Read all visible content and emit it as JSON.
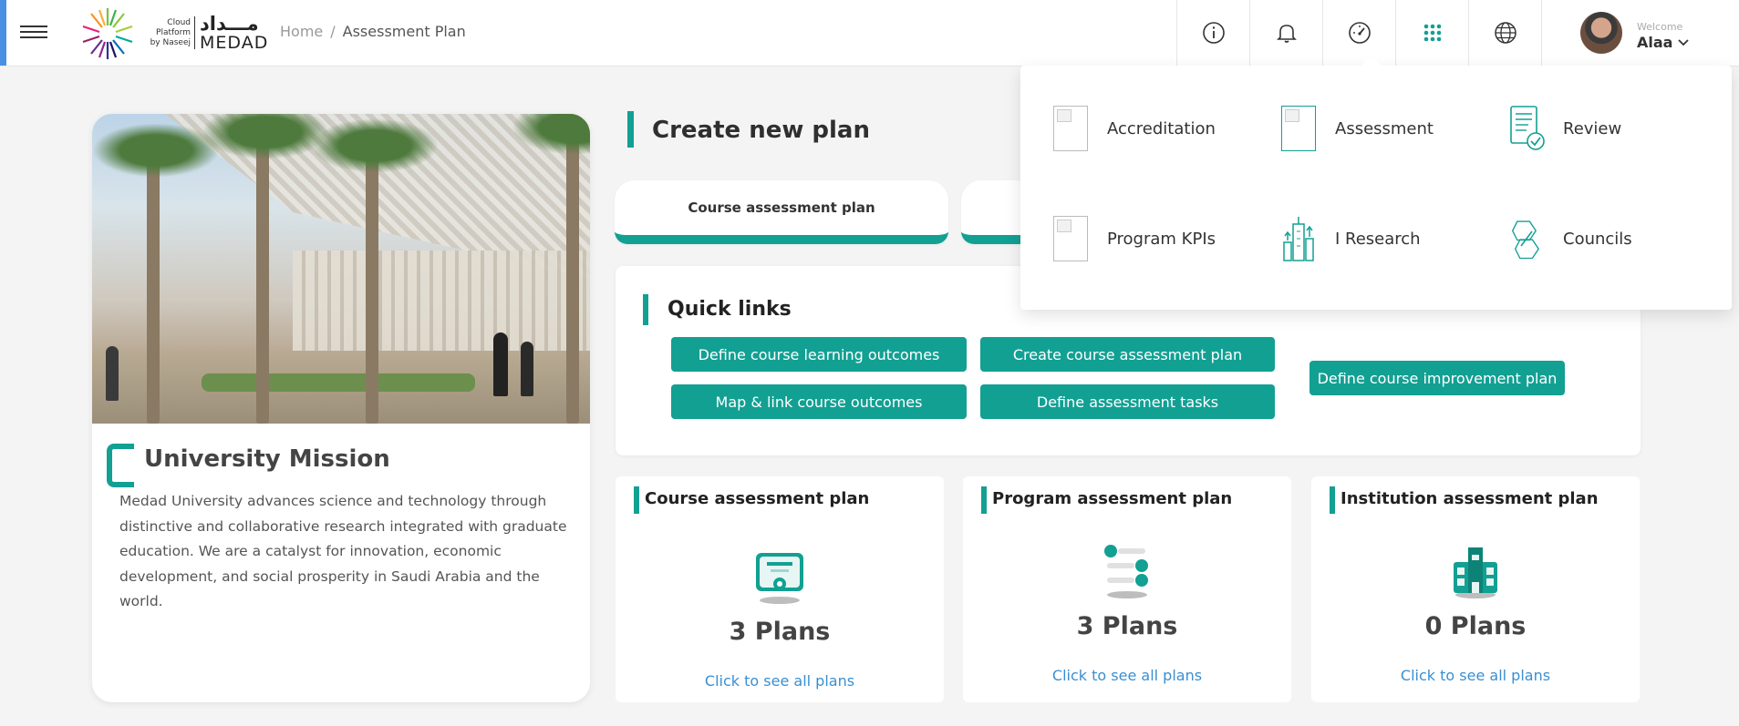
{
  "header": {
    "logo_caption": "Cloud\nPlatform\nby Naseej",
    "logo_arabic": "مـــداد",
    "logo_english": "MEDAD",
    "breadcrumb": {
      "home": "Home",
      "separator": "/",
      "current": "Assessment Plan"
    },
    "icons": [
      "info-icon",
      "bell-icon",
      "dashboard-icon",
      "apps-grid-icon",
      "globe-icon"
    ],
    "user": {
      "welcome": "Welcome",
      "name": "Alaa"
    }
  },
  "apps_menu": {
    "items": [
      {
        "label": "Accreditation",
        "icon": "accreditation-icon"
      },
      {
        "label": "Assessment",
        "icon": "assessment-icon"
      },
      {
        "label": "Review",
        "icon": "review-icon"
      },
      {
        "label": "Program KPIs",
        "icon": "kpis-icon"
      },
      {
        "label": "I Research",
        "icon": "research-icon"
      },
      {
        "label": "Councils",
        "icon": "councils-icon"
      }
    ]
  },
  "mission": {
    "title": "University Mission",
    "text": "Medad University advances science and technology through distinctive and collaborative research integrated with graduate education. We are a catalyst for innovation, economic development, and social prosperity in Saudi Arabia and the world."
  },
  "create_plan": {
    "title": "Create new plan",
    "tabs": [
      "Course assessment plan",
      ""
    ]
  },
  "quick_links": {
    "title": "Quick links",
    "buttons": [
      "Define course learning outcomes",
      "Create course assessment plan",
      "Define course improvement plan",
      "Map & link course outcomes",
      "Define assessment tasks"
    ]
  },
  "plans": [
    {
      "title": "Course assessment plan",
      "count": "3 Plans",
      "link": "Click to see all plans",
      "icon": "certificate-icon"
    },
    {
      "title": "Program assessment plan",
      "count": "3 Plans",
      "link": "Click to see all plans",
      "icon": "program-list-icon"
    },
    {
      "title": "Institution assessment plan",
      "count": "0 Plans",
      "link": "Click to see all plans",
      "icon": "building-icon"
    }
  ],
  "colors": {
    "accent": "#12a093",
    "link": "#3a8fd1",
    "header_stripe": "#4a90e2"
  }
}
